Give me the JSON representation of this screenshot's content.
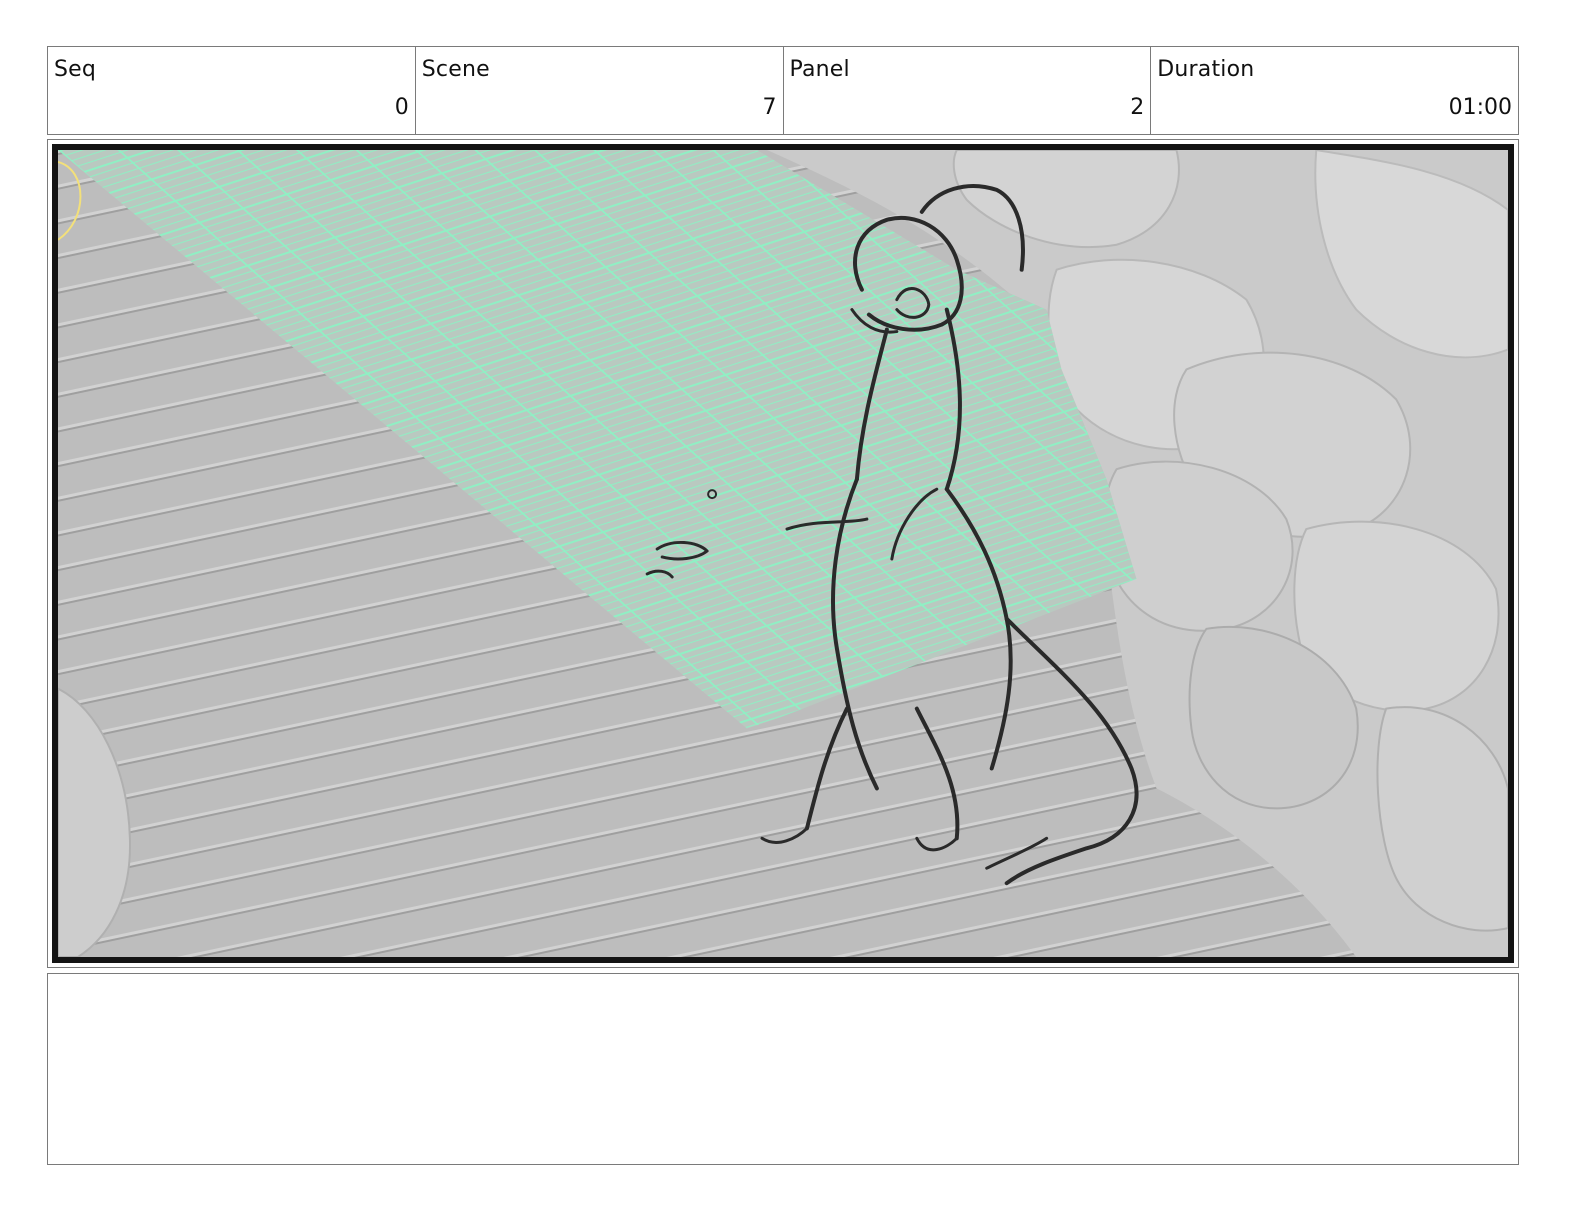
{
  "header": {
    "fields": [
      {
        "label": "Seq",
        "value": "0"
      },
      {
        "label": "Scene",
        "value": "7"
      },
      {
        "label": "Panel",
        "value": "2"
      },
      {
        "label": "Duration",
        "value": "01:00"
      }
    ]
  },
  "panel": {
    "colors": {
      "floor": "#bdbdbd",
      "rock": "#cfcfcf",
      "grid": "#8ff0c4",
      "sketch_line": "#2a2a2a",
      "frame_border": "#141414"
    }
  },
  "notes": {
    "text": ""
  }
}
